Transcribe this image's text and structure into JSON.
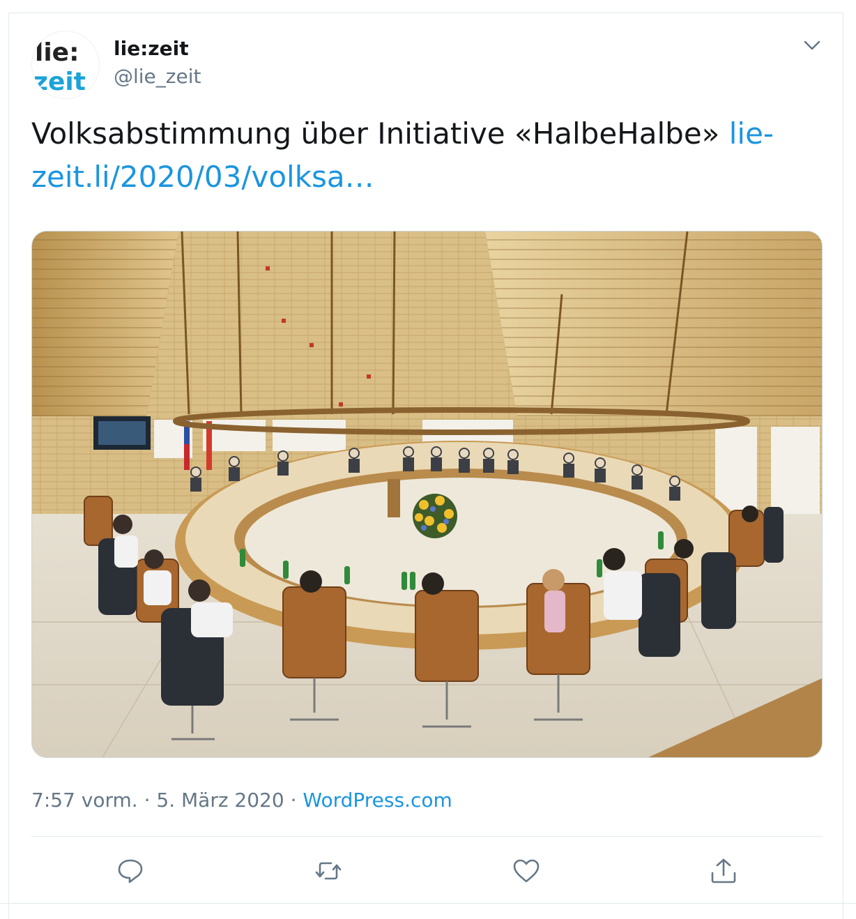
{
  "account": {
    "logo_text_top": "lie:",
    "logo_text_bottom": "zeit",
    "display_name": "lie:zeit",
    "handle": "@lie_zeit"
  },
  "tweet": {
    "text": "Volksabstimmung über Initiative «HalbeHalbe» ",
    "link_text": "lie-zeit.li/2020/03/volksa…",
    "link_text_line1": "lie-",
    "link_text_line2": "zeit.li/2020/03/volksa…",
    "photo_icon": "parliament-chamber-photo"
  },
  "meta": {
    "time": "7:57 vorm.",
    "separator": " · ",
    "date": "5. März 2020",
    "source": "WordPress.com"
  },
  "actions": {
    "reply": "reply-icon",
    "retweet": "retweet-icon",
    "like": "heart-icon",
    "share": "share-icon"
  },
  "colors": {
    "link": "#1b95e0",
    "secondary_text": "#657786",
    "logo_dark": "#222222",
    "logo_blue": "#1ba3d9",
    "icon": "#657786"
  }
}
